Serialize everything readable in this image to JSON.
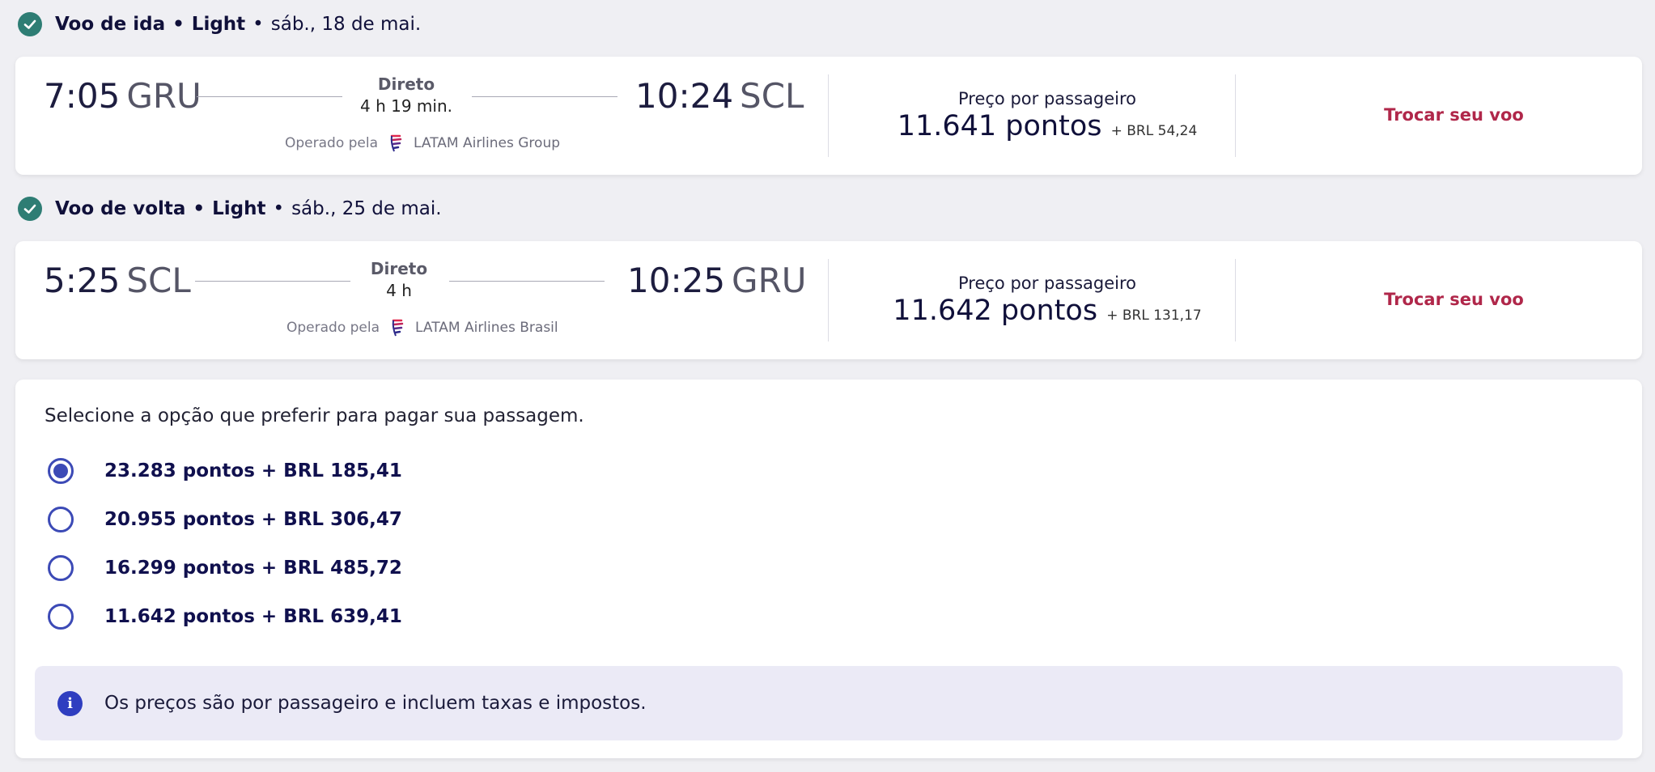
{
  "outbound": {
    "header": {
      "title": "Voo de ida",
      "fare": "Light",
      "date": "sáb., 18 de mai."
    },
    "depart_time": "7:05",
    "depart_code": "GRU",
    "direct_label": "Direto",
    "duration": "4 h 19 min.",
    "arrive_time": "10:24",
    "arrive_code": "SCL",
    "operated_by_label": "Operado pela",
    "airline": "LATAM Airlines Group",
    "price_label": "Preço por passageiro",
    "price_points": "11.641 pontos",
    "price_extra": "+ BRL 54,24",
    "change_label": "Trocar seu voo"
  },
  "return": {
    "header": {
      "title": "Voo de volta",
      "fare": "Light",
      "date": "sáb., 25 de mai."
    },
    "depart_time": "5:25",
    "depart_code": "SCL",
    "direct_label": "Direto",
    "duration": "4 h",
    "arrive_time": "10:25",
    "arrive_code": "GRU",
    "operated_by_label": "Operado pela",
    "airline": "LATAM Airlines Brasil",
    "price_label": "Preço por passageiro",
    "price_points": "11.642 pontos",
    "price_extra": "+ BRL 131,17",
    "change_label": "Trocar seu voo"
  },
  "payment": {
    "title": "Selecione a opção que preferir para pagar sua passagem.",
    "options": [
      {
        "label": "23.283 pontos + BRL 185,41",
        "selected": true
      },
      {
        "label": "20.955 pontos + BRL 306,47",
        "selected": false
      },
      {
        "label": "16.299 pontos + BRL 485,72",
        "selected": false
      },
      {
        "label": "11.642 pontos + BRL 639,41",
        "selected": false
      }
    ],
    "info_text": "Os preços são por passageiro e incluem taxas e impostos."
  },
  "icons": {
    "check": "check-circle-icon",
    "info": "info-icon",
    "logo": "latam-logo-icon"
  },
  "colors": {
    "accent": "#b0274a",
    "radio": "#3c4ab6",
    "check": "#2e7d74",
    "info": "#2f3ec0"
  }
}
